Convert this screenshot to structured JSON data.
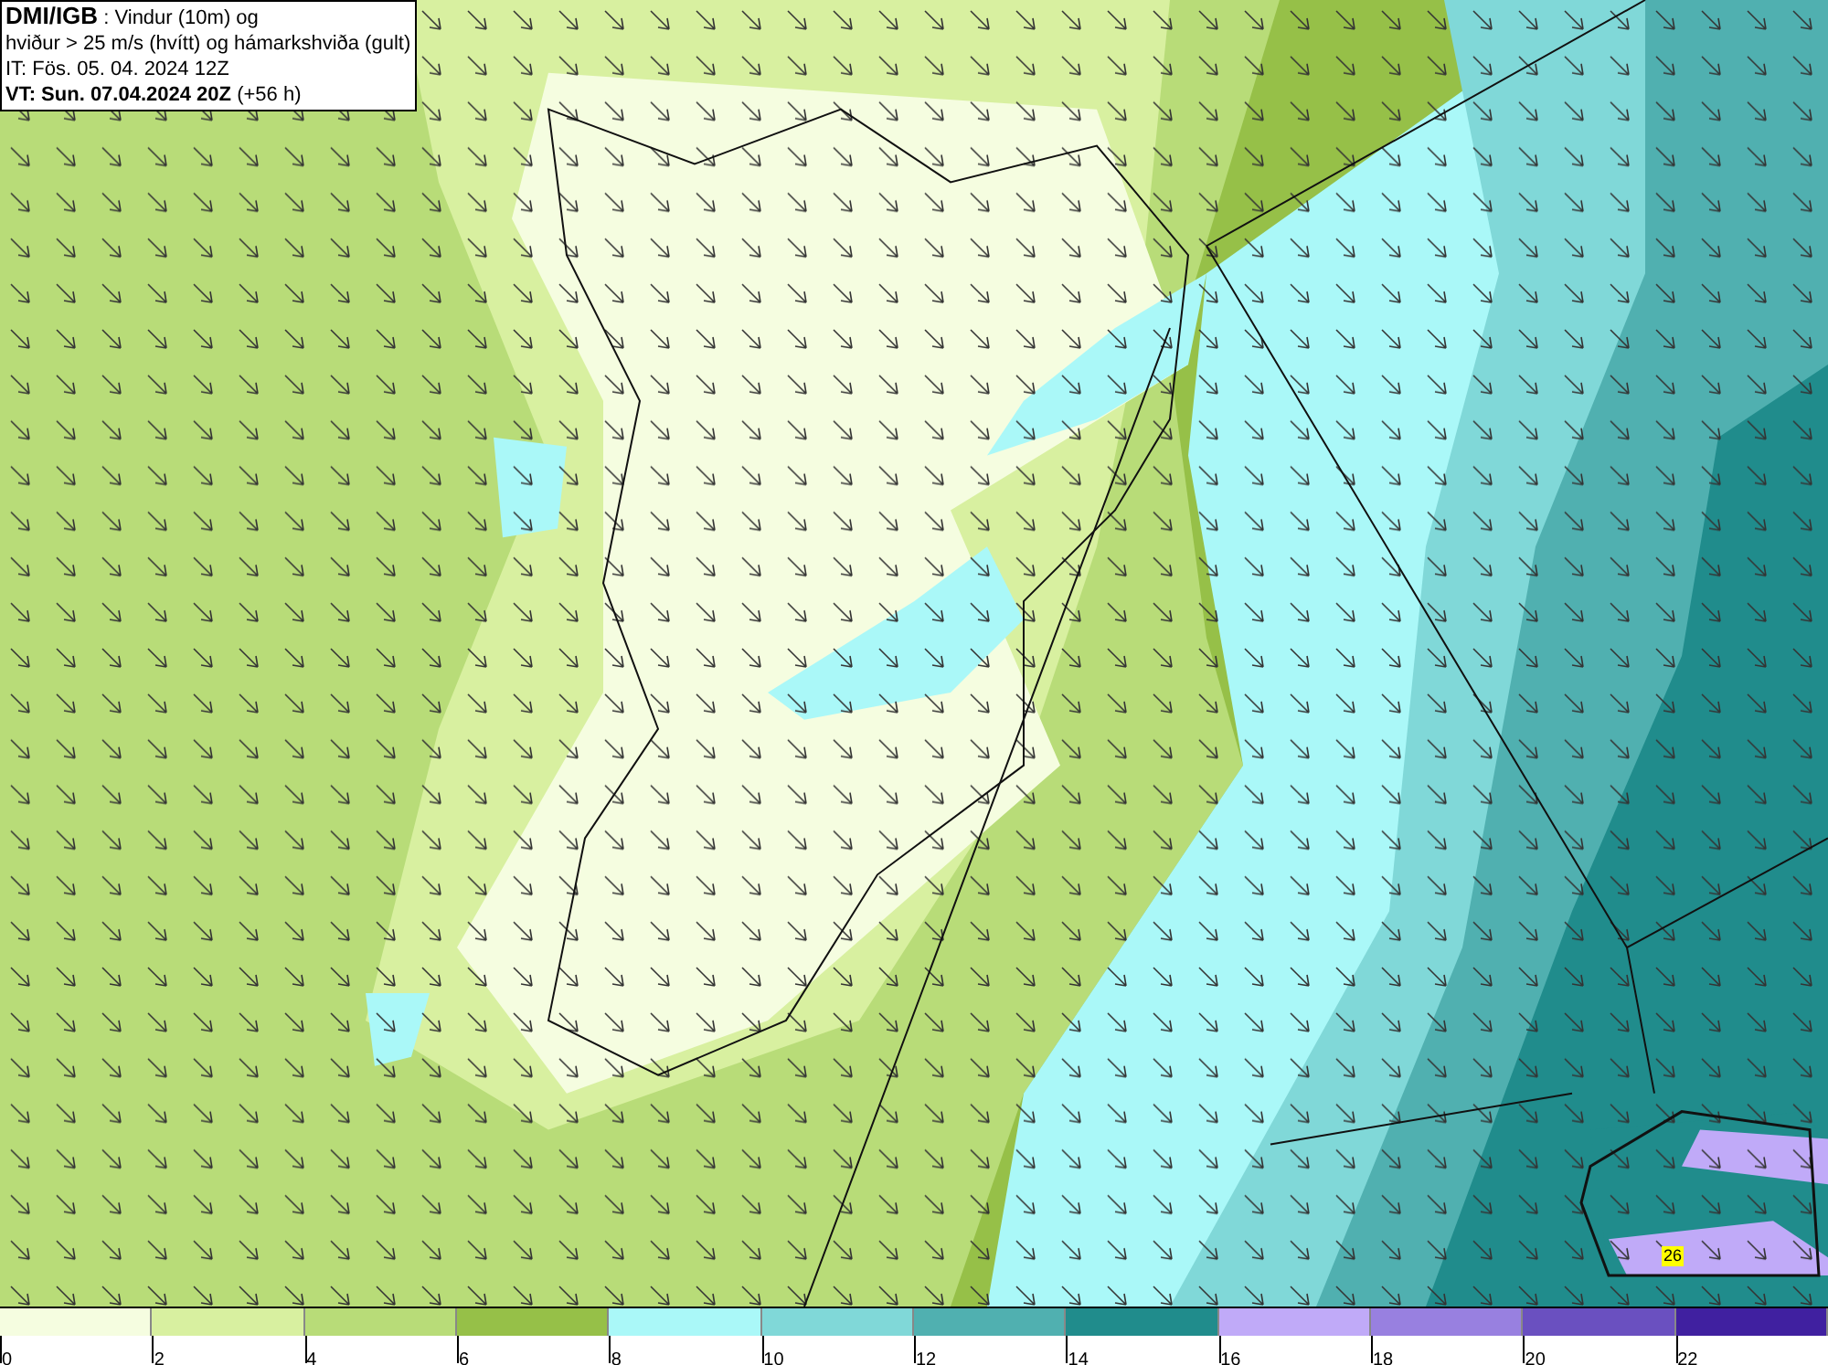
{
  "legend": {
    "title": "DMI/IGB",
    "title_rest": ": Vindur (10m) og",
    "line_2": "hviður > 25 m/s (hvítt) og hámarkshviða (gult)",
    "line_3": "IT: Fös. 05. 04. 2024 12Z",
    "valid_time": "VT: Sun. 07.04.2024 20Z",
    "valid_offset": "(+56 h)"
  },
  "gust_label": "26",
  "colorbar": {
    "bins": [
      {
        "color": "#f5fde0"
      },
      {
        "color": "#d8f0a0"
      },
      {
        "color": "#b8dc78"
      },
      {
        "color": "#96c048"
      },
      {
        "color": "#aaf8f8"
      },
      {
        "color": "#80d8d8"
      },
      {
        "color": "#50b0b0"
      },
      {
        "color": "#208c8c"
      },
      {
        "color": "#c0aaf8"
      },
      {
        "color": "#9880e0"
      },
      {
        "color": "#6a50c0"
      },
      {
        "color": "#4020a0"
      }
    ],
    "ticks": [
      "0",
      "2",
      "4",
      "6",
      "8",
      "10",
      "12",
      "14",
      "16",
      "18",
      "20",
      "22"
    ]
  }
}
